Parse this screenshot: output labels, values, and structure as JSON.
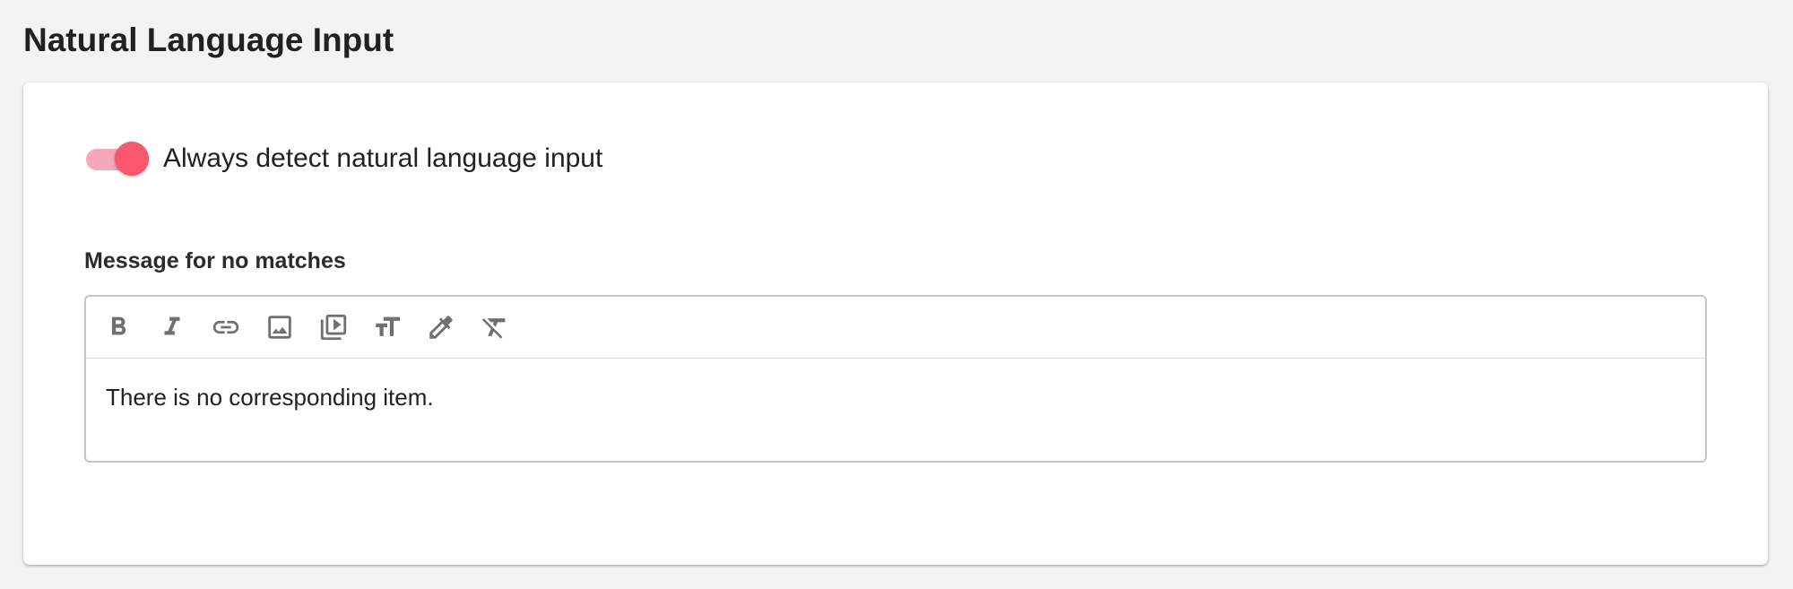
{
  "page": {
    "title": "Natural Language Input"
  },
  "toggle": {
    "label": "Always detect natural language input",
    "checked": true,
    "accent_color": "#f9566f",
    "track_color": "#f7a7bb"
  },
  "message_section": {
    "label": "Message for no matches",
    "content": "There is no corresponding item."
  },
  "toolbar": {
    "tools": [
      {
        "name": "bold",
        "icon": "bold-icon"
      },
      {
        "name": "italic",
        "icon": "italic-icon"
      },
      {
        "name": "link",
        "icon": "link-icon"
      },
      {
        "name": "image",
        "icon": "image-icon"
      },
      {
        "name": "video",
        "icon": "video-library-icon"
      },
      {
        "name": "text-size",
        "icon": "text-size-icon"
      },
      {
        "name": "color",
        "icon": "eyedropper-icon"
      },
      {
        "name": "clear-formatting",
        "icon": "clear-format-icon"
      }
    ]
  }
}
